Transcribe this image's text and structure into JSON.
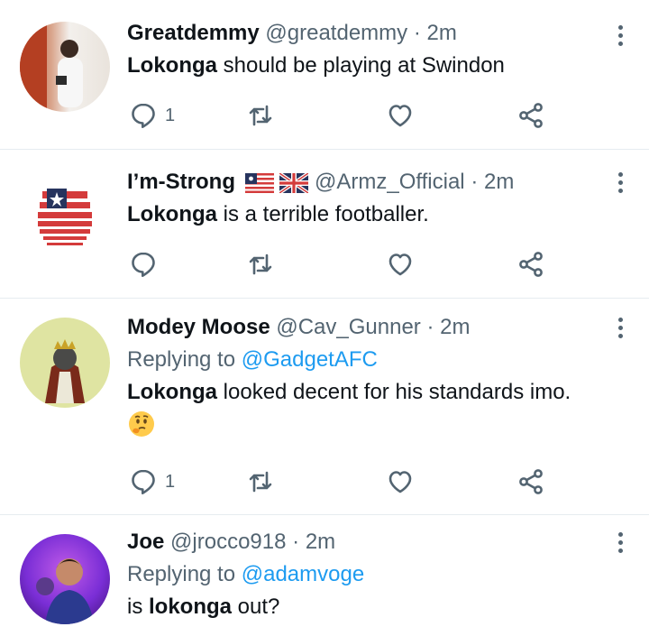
{
  "tweets": [
    {
      "name": "Greatdemmy",
      "handle": "@greatdemmy",
      "dot": "·",
      "time": "2m",
      "text_bold": "Lokonga",
      "text_rest": " should be playing at Swindon",
      "reply_count": "1"
    },
    {
      "name": "I’m-Strong",
      "handle": "@Armz_Official",
      "dot": "·",
      "time": "2m",
      "text_bold": "Lokonga",
      "text_rest": " is a terrible footballer.",
      "reply_count": ""
    },
    {
      "name": "Modey Moose",
      "handle": "@Cav_Gunner",
      "dot": "·",
      "time": "2m",
      "replying_prefix": "Replying to ",
      "replying_to": "@GadgetAFC",
      "text_bold": "Lokonga",
      "text_rest": " looked decent for his standards imo.",
      "reply_count": "1"
    },
    {
      "name": "Joe",
      "handle": "@jrocco918",
      "dot": "·",
      "time": "2m",
      "replying_prefix": "Replying to ",
      "replying_to": "@adamvoge",
      "text_pre": "is ",
      "text_bold": "lokonga",
      "text_rest": " out?"
    }
  ],
  "colors": {
    "accent": "#1d9bf0",
    "secondary_text": "#536471",
    "divider": "#e6ecf0"
  },
  "icons": [
    "reply-icon",
    "retweet-icon",
    "like-icon",
    "share-icon",
    "more-icon",
    "thinking-face-emoji"
  ]
}
